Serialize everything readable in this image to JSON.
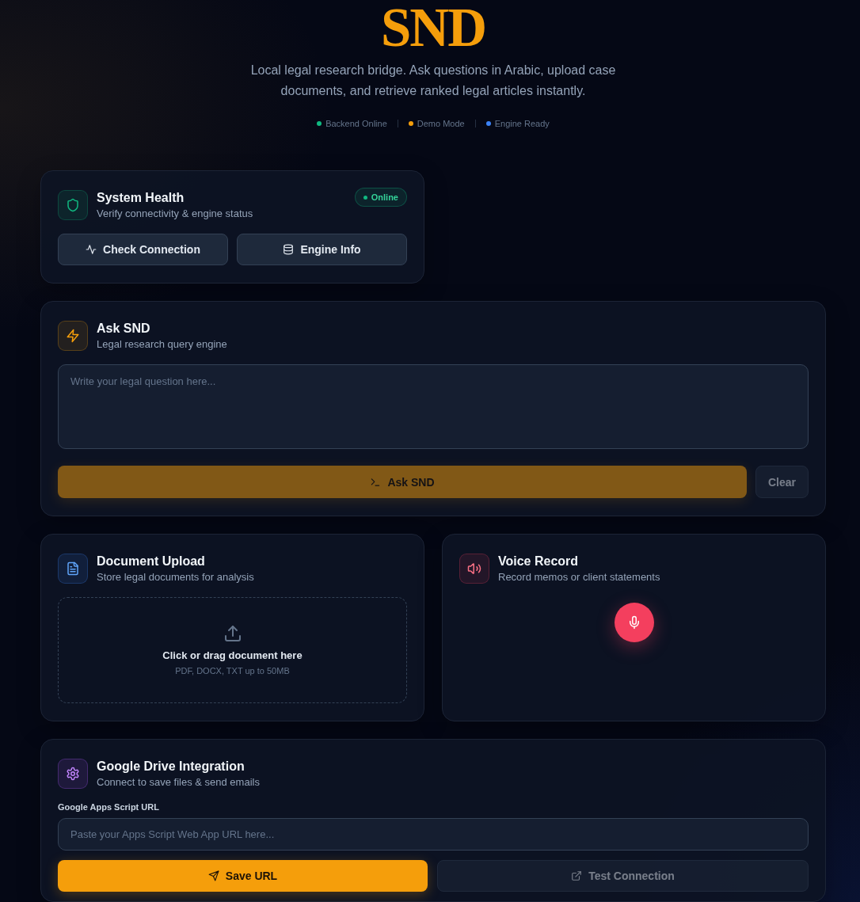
{
  "header": {
    "title": "SND",
    "subtitle": "Local legal research bridge. Ask questions in Arabic, upload case documents, and retrieve ranked legal articles instantly.",
    "statuses": [
      {
        "label": "Backend Online",
        "color": "#10b981"
      },
      {
        "label": "Demo Mode",
        "color": "#f59e0b"
      },
      {
        "label": "Engine Ready",
        "color": "#3b82f6"
      }
    ]
  },
  "cards": [
    {
      "kind": "health",
      "title": "System Health",
      "subtitle": "Verify connectivity & engine status",
      "badge": "Online",
      "actions": [
        {
          "kind": "secondary",
          "label": "Check Connection",
          "disabled": false
        },
        {
          "kind": "secondary",
          "label": "Engine Info",
          "disabled": false
        }
      ]
    },
    {
      "kind": "query",
      "title": "Ask SND",
      "subtitle": "Legal research query engine",
      "question": {
        "placeholder": "Write your legal question here..."
      },
      "actions": [
        {
          "kind": "primary",
          "label": "Ask SND",
          "disabled": true
        },
        {
          "kind": "secondary",
          "label": "Clear",
          "disabled": true
        }
      ]
    },
    {
      "kind": "upload",
      "title": "Document Upload",
      "subtitle": "Store legal documents for analysis",
      "dropzone": {
        "label": "Click or drag document here",
        "hint": "PDF, DOCX, TXT up to 50MB"
      }
    },
    {
      "kind": "voice",
      "title": "Voice Record",
      "subtitle": "Record memos or client statements"
    },
    {
      "kind": "drive",
      "title": "Google Drive Integration",
      "subtitle": "Connect to save files & send emails",
      "url": {
        "label": "Google Apps Script URL",
        "placeholder": "Paste your Apps Script Web App URL here..."
      },
      "actions": [
        {
          "kind": "primary",
          "label": "Save URL",
          "disabled": false
        },
        {
          "kind": "secondary",
          "label": "Test Connection",
          "disabled": true
        }
      ]
    }
  ]
}
